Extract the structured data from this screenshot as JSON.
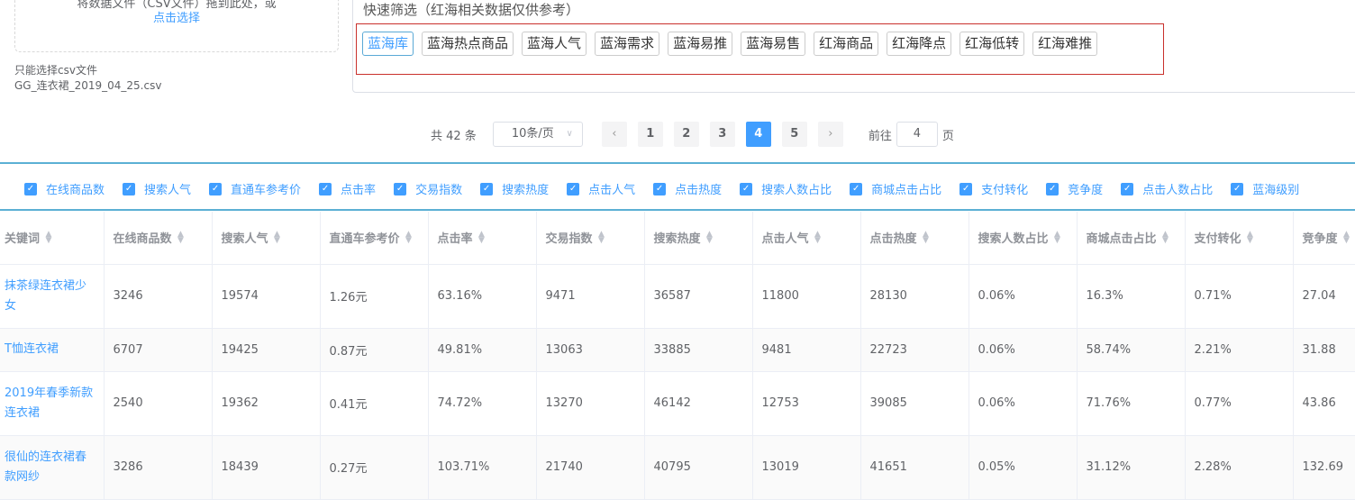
{
  "upload": {
    "hint": "将数据文件（CSV文件）拖到此处，或",
    "pick": "点击选择",
    "tip": "只能选择csv文件",
    "file": "GG_连衣裙_2019_04_25.csv"
  },
  "quick": {
    "title": "快速筛选（红海相关数据仅供参考）",
    "tags": [
      "蓝海库",
      "蓝海热点商品",
      "蓝海人气",
      "蓝海需求",
      "蓝海易推",
      "蓝海易售",
      "红海商品",
      "红海降点",
      "红海低转",
      "红海难推"
    ],
    "active": 0
  },
  "pager": {
    "total": "共 42 条",
    "size": "10条/页",
    "pages": [
      "1",
      "2",
      "3",
      "4",
      "5"
    ],
    "current": "4",
    "goto_label": "前往",
    "goto_value": "4",
    "page_suffix": "页"
  },
  "columns_toggle": [
    "在线商品数",
    "搜索人气",
    "直通车参考价",
    "点击率",
    "交易指数",
    "搜索热度",
    "点击人气",
    "点击热度",
    "搜索人数占比",
    "商城点击占比",
    "支付转化",
    "竞争度",
    "点击人数占比",
    "蓝海级别"
  ],
  "table": {
    "headers": [
      "关键词",
      "在线商品数",
      "搜索人气",
      "直通车参考价",
      "点击率",
      "交易指数",
      "搜索热度",
      "点击人气",
      "点击热度",
      "搜索人数占比",
      "商城点击占比",
      "支付转化",
      "竞争度"
    ],
    "rows": [
      [
        "抹茶绿连衣裙少女",
        "3246",
        "19574",
        "1.26元",
        "63.16%",
        "9471",
        "36587",
        "11800",
        "28130",
        "0.06%",
        "16.3%",
        "0.71%",
        "27.04"
      ],
      [
        "T恤连衣裙",
        "6707",
        "19425",
        "0.87元",
        "49.81%",
        "13063",
        "33885",
        "9481",
        "22723",
        "0.06%",
        "58.74%",
        "2.21%",
        "31.88"
      ],
      [
        "2019年春季新款连衣裙",
        "2540",
        "19362",
        "0.41元",
        "74.72%",
        "13270",
        "46142",
        "12753",
        "39085",
        "0.06%",
        "71.76%",
        "0.77%",
        "43.86"
      ],
      [
        "很仙的连衣裙春款网纱",
        "3286",
        "18439",
        "0.27元",
        "103.71%",
        "21740",
        "40795",
        "13019",
        "41651",
        "0.05%",
        "31.12%",
        "2.28%",
        "132.69"
      ]
    ]
  }
}
